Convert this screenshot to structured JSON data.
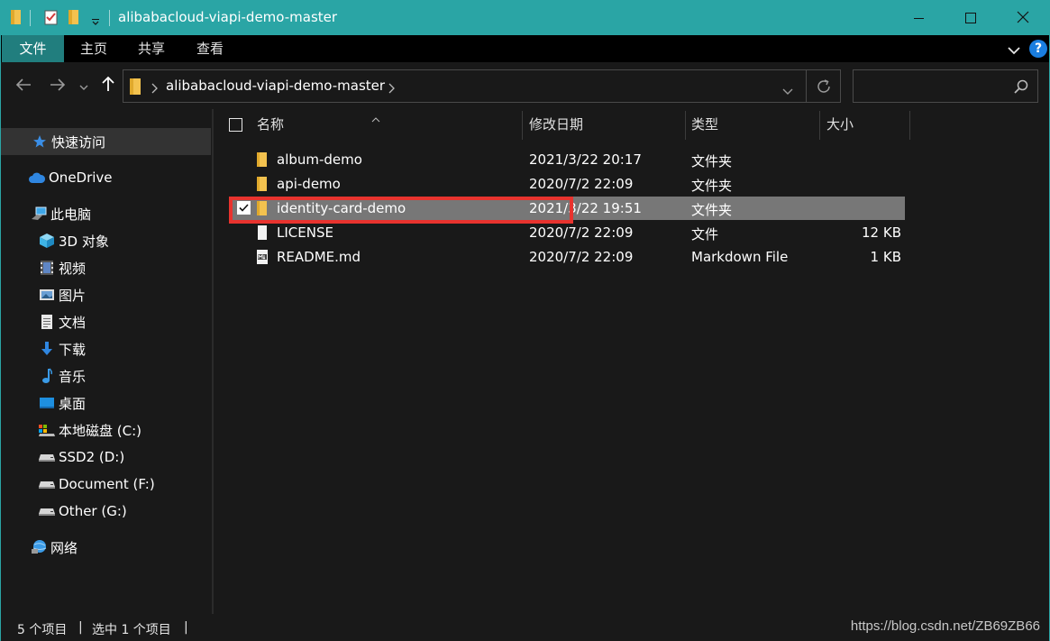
{
  "window": {
    "title": "alibabacloud-viapi-demo-master"
  },
  "ribbon": {
    "tabs": [
      "文件",
      "主页",
      "共享",
      "查看"
    ],
    "help_label": "?"
  },
  "address": {
    "path": "alibabacloud-viapi-demo-master"
  },
  "search": {
    "placeholder": ""
  },
  "sidebar": {
    "items": [
      {
        "label": "快速访问",
        "icon": "star-icon",
        "selected": true
      },
      {
        "label": "OneDrive",
        "icon": "cloud-icon"
      },
      {
        "label": "此电脑",
        "icon": "computer-icon"
      },
      {
        "label": "3D 对象",
        "icon": "cube-icon"
      },
      {
        "label": "视频",
        "icon": "video-icon"
      },
      {
        "label": "图片",
        "icon": "picture-icon"
      },
      {
        "label": "文档",
        "icon": "document-icon"
      },
      {
        "label": "下载",
        "icon": "download-icon"
      },
      {
        "label": "音乐",
        "icon": "music-icon"
      },
      {
        "label": "桌面",
        "icon": "desktop-icon"
      },
      {
        "label": "本地磁盘 (C:)",
        "icon": "system-drive-icon"
      },
      {
        "label": "SSD2 (D:)",
        "icon": "drive-icon"
      },
      {
        "label": "Document (F:)",
        "icon": "drive-icon"
      },
      {
        "label": "Other (G:)",
        "icon": "drive-icon"
      },
      {
        "label": "网络",
        "icon": "network-icon"
      }
    ]
  },
  "columns": {
    "name": "名称",
    "modified": "修改日期",
    "type": "类型",
    "size": "大小"
  },
  "files": [
    {
      "name": "album-demo",
      "modified": "2021/3/22 20:17",
      "type": "文件夹",
      "size": "",
      "icon": "folder-icon"
    },
    {
      "name": "api-demo",
      "modified": "2020/7/2 22:09",
      "type": "文件夹",
      "size": "",
      "icon": "folder-icon"
    },
    {
      "name": "identity-card-demo",
      "modified": "2021/3/22 19:51",
      "type": "文件夹",
      "size": "",
      "icon": "folder-icon",
      "selected": true
    },
    {
      "name": "LICENSE",
      "modified": "2020/7/2 22:09",
      "type": "文件",
      "size": "12 KB",
      "icon": "file-icon"
    },
    {
      "name": "README.md",
      "modified": "2020/7/2 22:09",
      "type": "Markdown File",
      "size": "1 KB",
      "icon": "markdown-file-icon"
    }
  ],
  "status": {
    "item_count": "5 个项目",
    "selected_count": "选中 1 个项目",
    "separator": "|"
  },
  "watermark": "https://blog.csdn.net/ZB69ZB66",
  "colors": {
    "titlebar": "#2aa5a5",
    "file_tab": "#217e7e",
    "selection": "#777777",
    "annotation_red": "#e8332e",
    "folder": "#f3c24f"
  }
}
